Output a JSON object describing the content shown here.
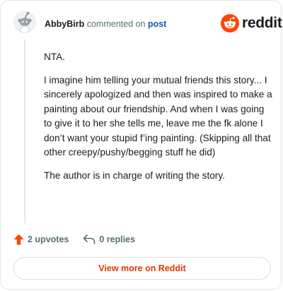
{
  "header": {
    "author": "AbbyBirb",
    "action_text": "commented on",
    "post_link": "post"
  },
  "brand": {
    "logo_icon": "reddit-snoo-icon",
    "wordmark": "reddit",
    "accent_color": "#ff4500"
  },
  "comment": {
    "paragraphs": [
      "NTA.",
      "I imagine him telling your mutual friends this story... I sincerely apologized and then was inspired to make a painting about our friendship. And when I was going to give it to her she tells me, leave me the fk alone I don’t want your stupid f’ing painting. (Skipping all that other creepy/pushy/begging stuff he did)",
      "The author is in charge of writing the story."
    ]
  },
  "actions": {
    "upvote_icon": "upvote-arrow-icon",
    "upvotes_label": "2 upvotes",
    "reply_icon": "reply-arrow-icon",
    "replies_label": "0 replies"
  },
  "view_more": {
    "label": "View more on Reddit"
  }
}
